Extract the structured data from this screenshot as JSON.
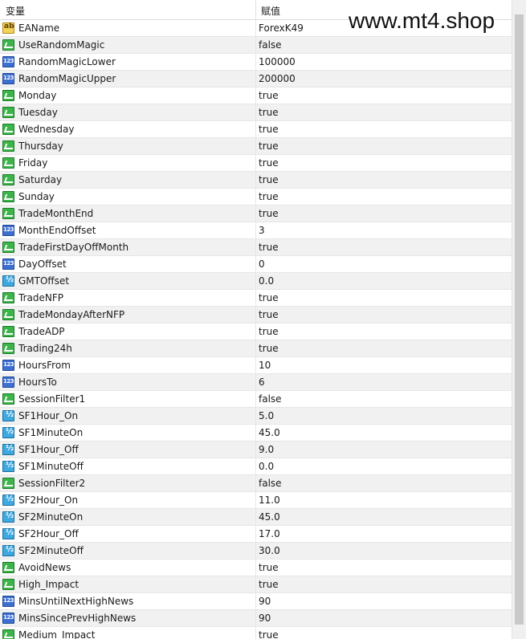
{
  "header": {
    "name_col": "变量",
    "value_col": "赋值"
  },
  "watermark": "www.mt4.shop",
  "rows": [
    {
      "name": "EAName",
      "value": "ForexK49",
      "icon": "string-icon"
    },
    {
      "name": "UseRandomMagic",
      "value": "false",
      "icon": "bool-icon"
    },
    {
      "name": "RandomMagicLower",
      "value": "100000",
      "icon": "int-icon"
    },
    {
      "name": "RandomMagicUpper",
      "value": "200000",
      "icon": "int-icon"
    },
    {
      "name": "Monday",
      "value": "true",
      "icon": "bool-icon"
    },
    {
      "name": "Tuesday",
      "value": "true",
      "icon": "bool-icon"
    },
    {
      "name": "Wednesday",
      "value": "true",
      "icon": "bool-icon"
    },
    {
      "name": "Thursday",
      "value": "true",
      "icon": "bool-icon"
    },
    {
      "name": "Friday",
      "value": "true",
      "icon": "bool-icon"
    },
    {
      "name": "Saturday",
      "value": "true",
      "icon": "bool-icon"
    },
    {
      "name": "Sunday",
      "value": "true",
      "icon": "bool-icon"
    },
    {
      "name": "TradeMonthEnd",
      "value": "true",
      "icon": "bool-icon"
    },
    {
      "name": "MonthEndOffset",
      "value": "3",
      "icon": "int-icon"
    },
    {
      "name": "TradeFirstDayOffMonth",
      "value": "true",
      "icon": "bool-icon"
    },
    {
      "name": "DayOffset",
      "value": "0",
      "icon": "int-icon"
    },
    {
      "name": "GMTOffset",
      "value": "0.0",
      "icon": "double-icon"
    },
    {
      "name": "TradeNFP",
      "value": "true",
      "icon": "bool-icon"
    },
    {
      "name": "TradeMondayAfterNFP",
      "value": "true",
      "icon": "bool-icon"
    },
    {
      "name": "TradeADP",
      "value": "true",
      "icon": "bool-icon"
    },
    {
      "name": "Trading24h",
      "value": "true",
      "icon": "bool-icon"
    },
    {
      "name": "HoursFrom",
      "value": "10",
      "icon": "int-icon"
    },
    {
      "name": "HoursTo",
      "value": "6",
      "icon": "int-icon"
    },
    {
      "name": "SessionFilter1",
      "value": "false",
      "icon": "bool-icon"
    },
    {
      "name": "SF1Hour_On",
      "value": "5.0",
      "icon": "double-icon"
    },
    {
      "name": "SF1MinuteOn",
      "value": "45.0",
      "icon": "double-icon"
    },
    {
      "name": "SF1Hour_Off",
      "value": "9.0",
      "icon": "double-icon"
    },
    {
      "name": "SF1MinuteOff",
      "value": "0.0",
      "icon": "double-icon"
    },
    {
      "name": "SessionFilter2",
      "value": "false",
      "icon": "bool-icon"
    },
    {
      "name": "SF2Hour_On",
      "value": "11.0",
      "icon": "double-icon"
    },
    {
      "name": "SF2MinuteOn",
      "value": "45.0",
      "icon": "double-icon"
    },
    {
      "name": "SF2Hour_Off",
      "value": "17.0",
      "icon": "double-icon"
    },
    {
      "name": "SF2MinuteOff",
      "value": "30.0",
      "icon": "double-icon"
    },
    {
      "name": "AvoidNews",
      "value": "true",
      "icon": "bool-icon"
    },
    {
      "name": "High_Impact",
      "value": "true",
      "icon": "bool-icon"
    },
    {
      "name": "MinsUntilNextHighNews",
      "value": "90",
      "icon": "int-icon"
    },
    {
      "name": "MinsSincePrevHighNews",
      "value": "90",
      "icon": "int-icon"
    },
    {
      "name": "Medium_Impact",
      "value": "true",
      "icon": "bool-icon"
    }
  ]
}
